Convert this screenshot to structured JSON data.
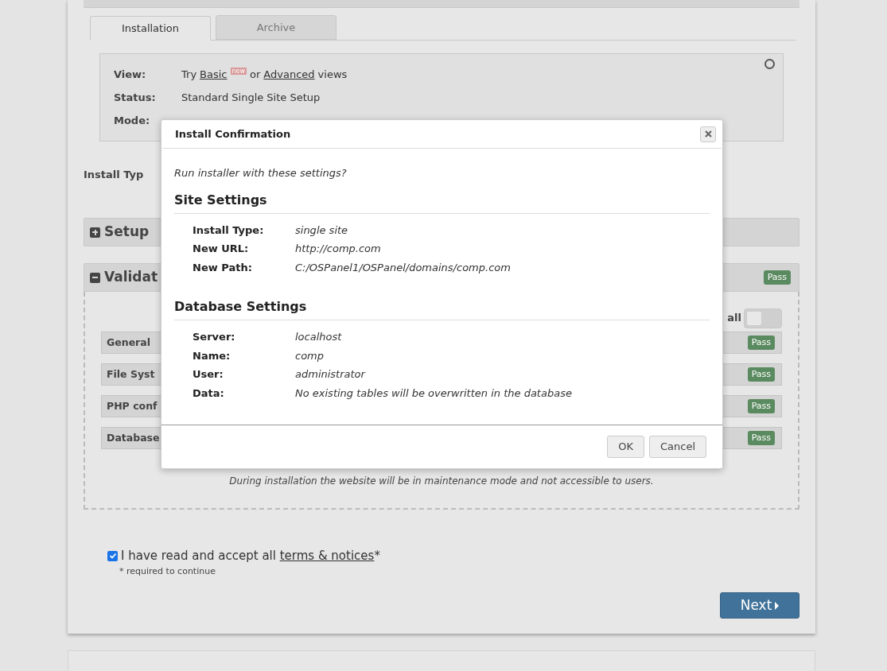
{
  "tabs": [
    {
      "label": "Installation",
      "selected": true
    },
    {
      "label": "Archive",
      "selected": false
    }
  ],
  "info": {
    "rows": [
      {
        "label": "View:",
        "parts": [
          "Try",
          "Basic",
          "new",
          "or",
          "Advanced",
          "views"
        ]
      },
      {
        "label": "Status:",
        "value": "Standard Single Site Setup"
      },
      {
        "label": "Mode:"
      }
    ]
  },
  "install_type_label": "Install Typ",
  "sections": [
    {
      "title": "Setup",
      "expanded": false
    },
    {
      "title": "Validat",
      "expanded": true,
      "badge": "Pass"
    }
  ],
  "validation": {
    "toggle_label": "all",
    "toggle_on": false,
    "checks": [
      {
        "label": "General",
        "badge": "Pass"
      },
      {
        "label": "File Syst",
        "badge": "Pass"
      },
      {
        "label": "PHP conf",
        "badge": "Pass"
      },
      {
        "label": "Database",
        "badge": "Pass"
      }
    ],
    "note": "During installation the website will be in maintenance mode and not accessible to users."
  },
  "terms": {
    "checked": true,
    "text": "I have read and accept all",
    "link": "terms & notices",
    "mark": "*",
    "required": "* required to continue"
  },
  "next_button": "Next",
  "modal": {
    "title": "Install Confirmation",
    "question": "Run installer with these settings?",
    "groups": [
      {
        "heading": "Site Settings",
        "rows": [
          {
            "label": "Install Type:",
            "value": "single site"
          },
          {
            "label": "New URL:",
            "value": "http://comp.com"
          },
          {
            "label": "New Path:",
            "value": "C:/OSPanel1/OSPanel/domains/comp.com"
          }
        ]
      },
      {
        "heading": "Database Settings",
        "rows": [
          {
            "label": "Server:",
            "value": "localhost"
          },
          {
            "label": "Name:",
            "value": "comp"
          },
          {
            "label": "User:",
            "value": "administrator"
          },
          {
            "label": "Data:",
            "value": "No existing tables will be overwritten in the database"
          }
        ]
      }
    ],
    "buttons": [
      "OK",
      "Cancel"
    ]
  }
}
